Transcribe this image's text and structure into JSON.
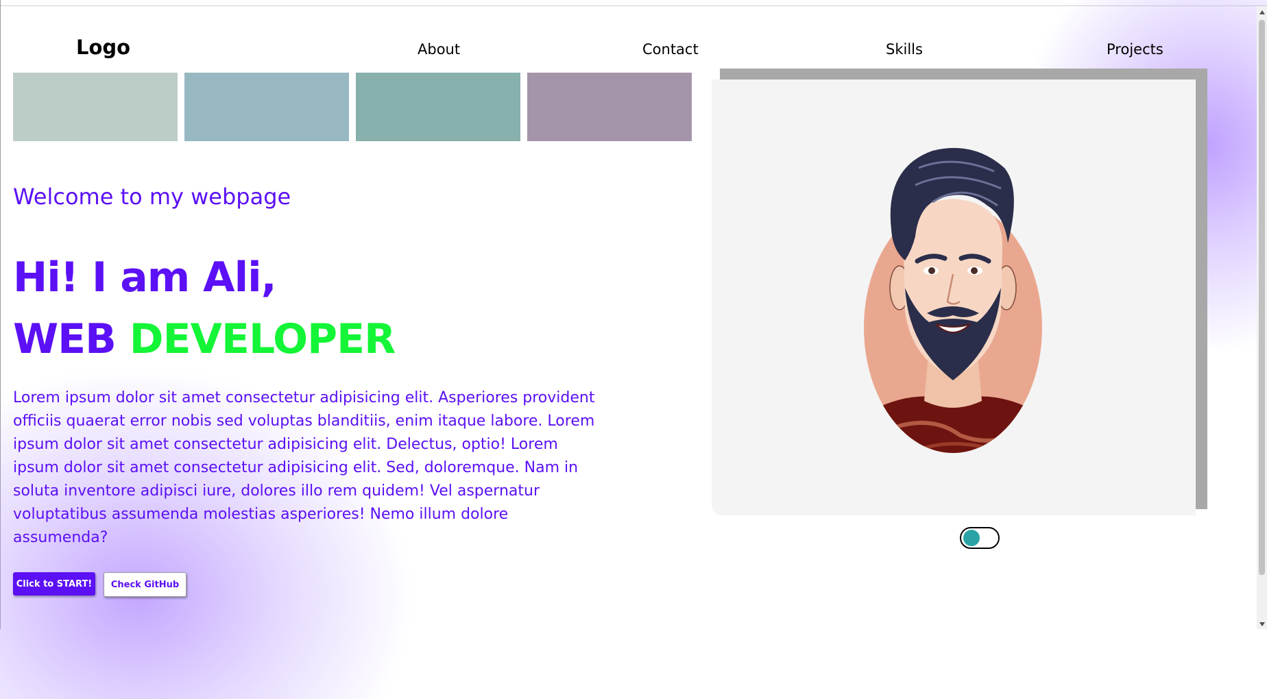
{
  "header": {
    "logo": "Logo",
    "nav": [
      "About",
      "Contact",
      "Skills",
      "Projects"
    ]
  },
  "swatches": [
    "#bccdc7",
    "#98b8c1",
    "#88b0ac",
    "#a595aa"
  ],
  "hero": {
    "welcome": "Welcome to my webpage",
    "greeting": "Hi! I am Ali,",
    "role_first": "WEB",
    "role_second": "DEVELOPER",
    "paragraph": "Lorem ipsum dolor sit amet consectetur adipisicing elit. Asperiores provident officiis quaerat error nobis sed voluptas blanditiis, enim itaque labore. Lorem ipsum dolor sit amet consectetur adipisicing elit. Delectus, optio! Lorem ipsum dolor sit amet consectetur adipisicing elit. Sed, doloremque. Nam in soluta inventore adipisci iure, dolores illo rem quidem! Vel aspernatur voluptatibus assumenda molestias asperiores! Nemo illum dolore assumenda?"
  },
  "buttons": {
    "start": "Click to START!",
    "github": "Check GitHub"
  },
  "colors": {
    "accent": "#5b10f5",
    "highlight": "#13f536",
    "toggle_knob": "#2aa3a6"
  },
  "icons": {
    "avatar": "cartoon-man-avatar",
    "toggle": "theme-toggle"
  }
}
